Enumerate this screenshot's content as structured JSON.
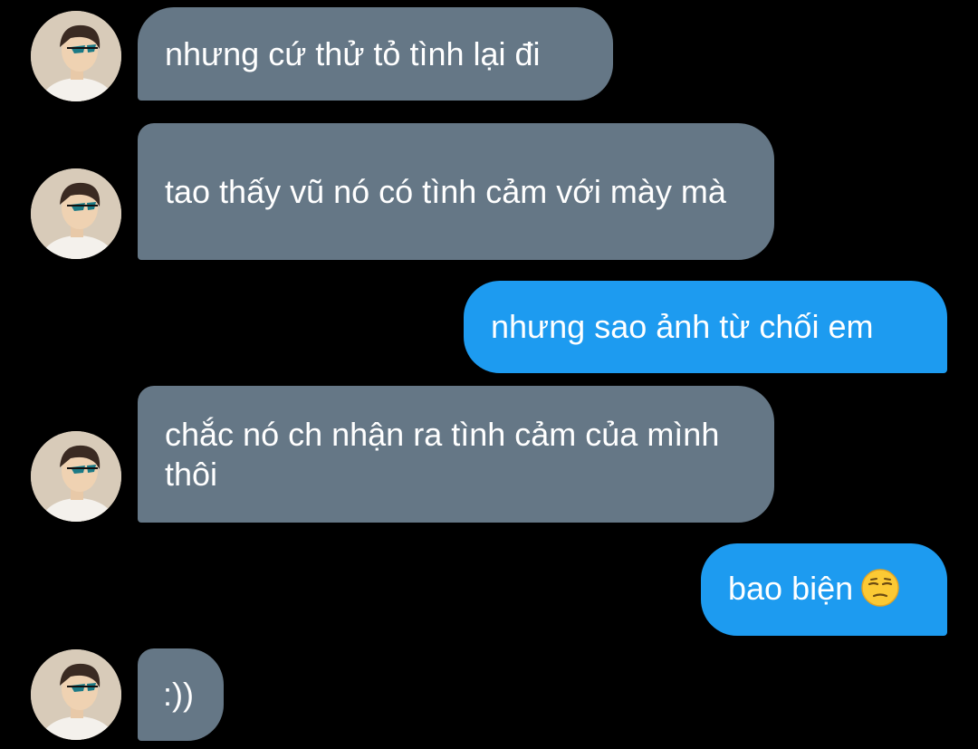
{
  "conversation": {
    "messages": [
      {
        "side": "incoming",
        "text": "nhưng cứ thử tỏ tình lại đi"
      },
      {
        "side": "incoming",
        "text": "tao thấy vũ nó có tình cảm với mày mà"
      },
      {
        "side": "outgoing",
        "text": "nhưng sao ảnh từ chối em"
      },
      {
        "side": "incoming",
        "text": "chắc nó ch nhận ra tình cảm của mình thôi"
      },
      {
        "side": "outgoing",
        "text": "bao biện",
        "emoji": "unamused-face"
      },
      {
        "side": "incoming",
        "text": ":))"
      }
    ]
  },
  "colors": {
    "background": "#000000",
    "incoming_bubble": "#657786",
    "outgoing_bubble": "#1d9bf0",
    "text": "#ffffff"
  }
}
